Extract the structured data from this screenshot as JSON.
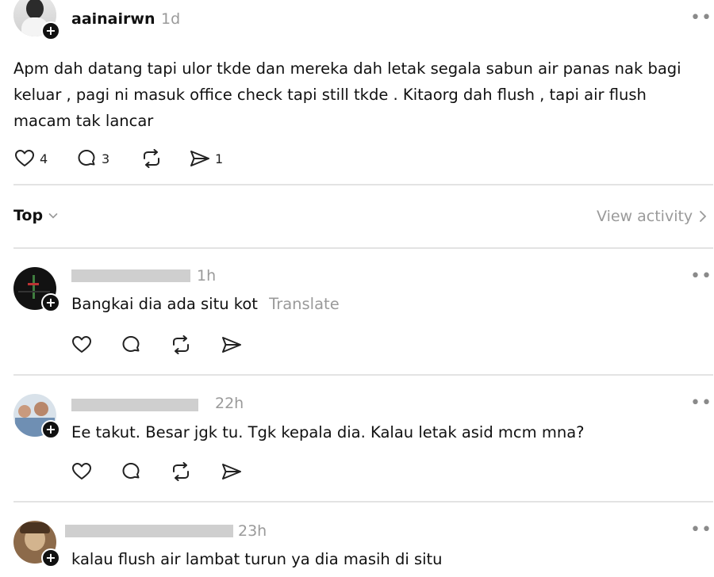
{
  "post": {
    "author": "aainairwn",
    "time": "1d",
    "text": "Apm dah datang tapi ulor tkde dan mereka dah letak segala sabun air panas nak bagi keluar , pagi ni masuk office check tapi still tkde . Kitaorg dah flush , tapi air flush macam tak lancar",
    "likes": "4",
    "replies": "3",
    "shares": "1",
    "more": "•••"
  },
  "sort": {
    "label": "Top",
    "activity": "View activity"
  },
  "comments": [
    {
      "time": "1h",
      "text": "Bangkai dia ada situ kot",
      "translate": "Translate"
    },
    {
      "time": "22h",
      "text": "Ee takut. Besar jgk tu. Tgk kepala dia. Kalau letak asid mcm mna?"
    },
    {
      "time": "23h",
      "text": "kalau flush air lambat turun ya dia masih di situ"
    }
  ]
}
